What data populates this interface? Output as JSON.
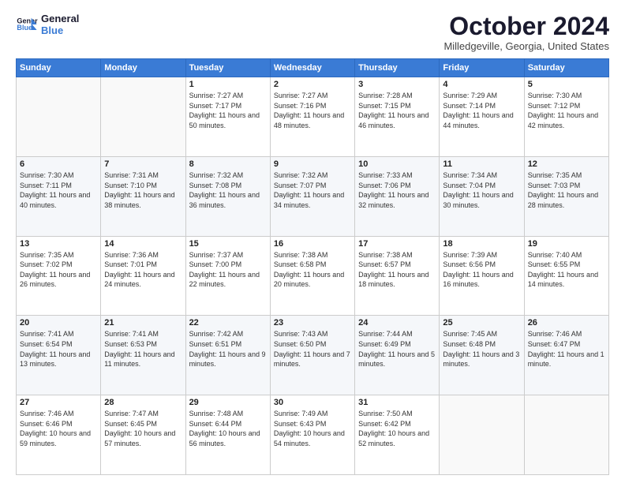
{
  "logo": {
    "line1": "General",
    "line2": "Blue",
    "icon_color": "#3a7bd5"
  },
  "title": "October 2024",
  "subtitle": "Milledgeville, Georgia, United States",
  "header_days": [
    "Sunday",
    "Monday",
    "Tuesday",
    "Wednesday",
    "Thursday",
    "Friday",
    "Saturday"
  ],
  "weeks": [
    [
      {
        "num": "",
        "info": ""
      },
      {
        "num": "",
        "info": ""
      },
      {
        "num": "1",
        "info": "Sunrise: 7:27 AM\nSunset: 7:17 PM\nDaylight: 11 hours and 50 minutes."
      },
      {
        "num": "2",
        "info": "Sunrise: 7:27 AM\nSunset: 7:16 PM\nDaylight: 11 hours and 48 minutes."
      },
      {
        "num": "3",
        "info": "Sunrise: 7:28 AM\nSunset: 7:15 PM\nDaylight: 11 hours and 46 minutes."
      },
      {
        "num": "4",
        "info": "Sunrise: 7:29 AM\nSunset: 7:14 PM\nDaylight: 11 hours and 44 minutes."
      },
      {
        "num": "5",
        "info": "Sunrise: 7:30 AM\nSunset: 7:12 PM\nDaylight: 11 hours and 42 minutes."
      }
    ],
    [
      {
        "num": "6",
        "info": "Sunrise: 7:30 AM\nSunset: 7:11 PM\nDaylight: 11 hours and 40 minutes."
      },
      {
        "num": "7",
        "info": "Sunrise: 7:31 AM\nSunset: 7:10 PM\nDaylight: 11 hours and 38 minutes."
      },
      {
        "num": "8",
        "info": "Sunrise: 7:32 AM\nSunset: 7:08 PM\nDaylight: 11 hours and 36 minutes."
      },
      {
        "num": "9",
        "info": "Sunrise: 7:32 AM\nSunset: 7:07 PM\nDaylight: 11 hours and 34 minutes."
      },
      {
        "num": "10",
        "info": "Sunrise: 7:33 AM\nSunset: 7:06 PM\nDaylight: 11 hours and 32 minutes."
      },
      {
        "num": "11",
        "info": "Sunrise: 7:34 AM\nSunset: 7:04 PM\nDaylight: 11 hours and 30 minutes."
      },
      {
        "num": "12",
        "info": "Sunrise: 7:35 AM\nSunset: 7:03 PM\nDaylight: 11 hours and 28 minutes."
      }
    ],
    [
      {
        "num": "13",
        "info": "Sunrise: 7:35 AM\nSunset: 7:02 PM\nDaylight: 11 hours and 26 minutes."
      },
      {
        "num": "14",
        "info": "Sunrise: 7:36 AM\nSunset: 7:01 PM\nDaylight: 11 hours and 24 minutes."
      },
      {
        "num": "15",
        "info": "Sunrise: 7:37 AM\nSunset: 7:00 PM\nDaylight: 11 hours and 22 minutes."
      },
      {
        "num": "16",
        "info": "Sunrise: 7:38 AM\nSunset: 6:58 PM\nDaylight: 11 hours and 20 minutes."
      },
      {
        "num": "17",
        "info": "Sunrise: 7:38 AM\nSunset: 6:57 PM\nDaylight: 11 hours and 18 minutes."
      },
      {
        "num": "18",
        "info": "Sunrise: 7:39 AM\nSunset: 6:56 PM\nDaylight: 11 hours and 16 minutes."
      },
      {
        "num": "19",
        "info": "Sunrise: 7:40 AM\nSunset: 6:55 PM\nDaylight: 11 hours and 14 minutes."
      }
    ],
    [
      {
        "num": "20",
        "info": "Sunrise: 7:41 AM\nSunset: 6:54 PM\nDaylight: 11 hours and 13 minutes."
      },
      {
        "num": "21",
        "info": "Sunrise: 7:41 AM\nSunset: 6:53 PM\nDaylight: 11 hours and 11 minutes."
      },
      {
        "num": "22",
        "info": "Sunrise: 7:42 AM\nSunset: 6:51 PM\nDaylight: 11 hours and 9 minutes."
      },
      {
        "num": "23",
        "info": "Sunrise: 7:43 AM\nSunset: 6:50 PM\nDaylight: 11 hours and 7 minutes."
      },
      {
        "num": "24",
        "info": "Sunrise: 7:44 AM\nSunset: 6:49 PM\nDaylight: 11 hours and 5 minutes."
      },
      {
        "num": "25",
        "info": "Sunrise: 7:45 AM\nSunset: 6:48 PM\nDaylight: 11 hours and 3 minutes."
      },
      {
        "num": "26",
        "info": "Sunrise: 7:46 AM\nSunset: 6:47 PM\nDaylight: 11 hours and 1 minute."
      }
    ],
    [
      {
        "num": "27",
        "info": "Sunrise: 7:46 AM\nSunset: 6:46 PM\nDaylight: 10 hours and 59 minutes."
      },
      {
        "num": "28",
        "info": "Sunrise: 7:47 AM\nSunset: 6:45 PM\nDaylight: 10 hours and 57 minutes."
      },
      {
        "num": "29",
        "info": "Sunrise: 7:48 AM\nSunset: 6:44 PM\nDaylight: 10 hours and 56 minutes."
      },
      {
        "num": "30",
        "info": "Sunrise: 7:49 AM\nSunset: 6:43 PM\nDaylight: 10 hours and 54 minutes."
      },
      {
        "num": "31",
        "info": "Sunrise: 7:50 AM\nSunset: 6:42 PM\nDaylight: 10 hours and 52 minutes."
      },
      {
        "num": "",
        "info": ""
      },
      {
        "num": "",
        "info": ""
      }
    ]
  ]
}
